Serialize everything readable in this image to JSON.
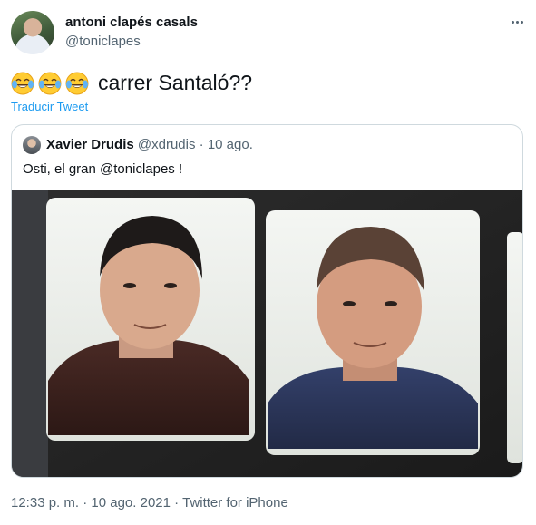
{
  "author": {
    "display_name": "antoni clapés casals",
    "handle": "@toniclapes",
    "avatar": "avatar-photo",
    "more_icon": "more-horizontal-icon"
  },
  "tweet": {
    "emojis": [
      "face-with-tears-of-joy",
      "face-with-tears-of-joy",
      "face-with-tears-of-joy"
    ],
    "text": "carrer Santaló??",
    "translate_label": "Traducir Tweet"
  },
  "quoted_tweet": {
    "author_name": "Xavier Drudis",
    "author_handle": "@xdrudis",
    "separator": "·",
    "date": "10 ago.",
    "text": "Osti, el gran @toniclapes !",
    "image": "photo-of-two-id-portrait-photos"
  },
  "footer": {
    "time": "12:33 p. m.",
    "separator": "·",
    "date": "10 ago. 2021",
    "source": "Twitter for iPhone"
  },
  "colors": {
    "link": "#1d9bf0",
    "secondary_text": "#536471",
    "border": "#cfd9de"
  }
}
